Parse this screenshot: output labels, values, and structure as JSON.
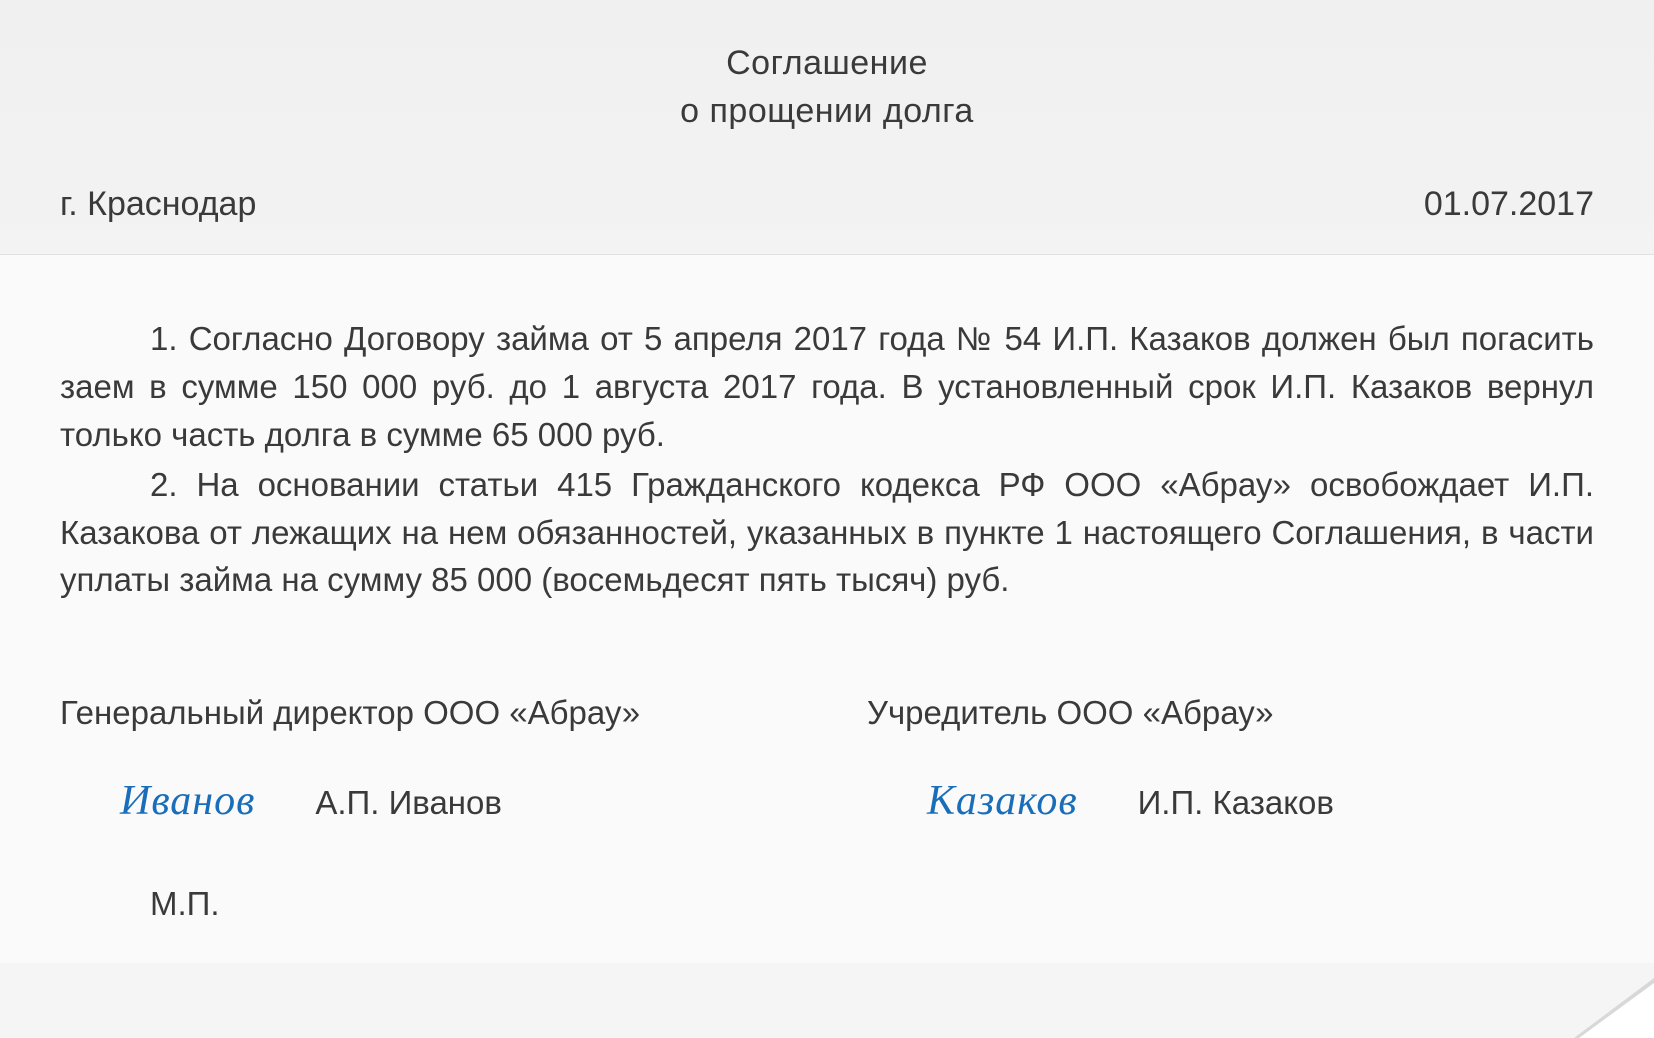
{
  "title": {
    "line1": "Соглашение",
    "line2": "о прощении долга"
  },
  "city": "г. Краснодар",
  "date": "01.07.2017",
  "paragraphs": {
    "p1": "1. Согласно Договору займа от 5 апреля 2017 года № 54 И.П. Казаков должен был погасить заем в сумме 150 000 руб. до 1 августа 2017 года. В установленный срок И.П. Казаков вернул только часть долга в сумме 65 000 руб.",
    "p2": "2. На основании статьи 415 Гражданского кодекса РФ ООО «Абрау» освобождает И.П. Казакова от лежащих на нем обязанностей, указанных в пункте 1 настоящего Соглашения, в части уплаты займа на сумму 85 000 (восемьдесят пять тысяч) руб."
  },
  "signatures": {
    "left": {
      "title": "Генеральный директор ООО «Абрау»",
      "signature": "Иванов",
      "name": "А.П. Иванов"
    },
    "right": {
      "title": "Учредитель ООО «Абрау»",
      "signature": "Казаков",
      "name": "И.П. Казаков"
    }
  },
  "stamp": "М.П."
}
